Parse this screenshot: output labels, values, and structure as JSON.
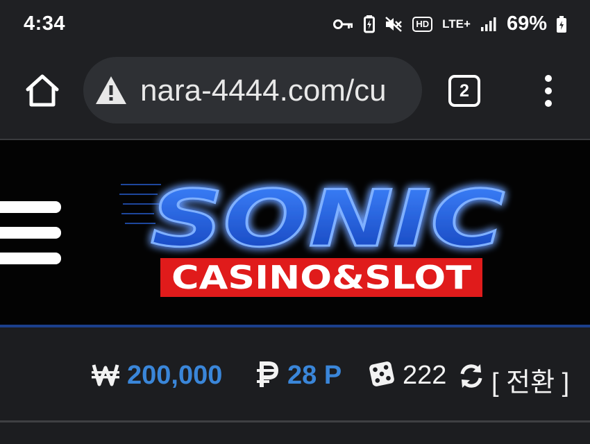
{
  "status_bar": {
    "time": "4:34",
    "battery_percent": "69%",
    "network": "LTE+",
    "hd_label": "HD"
  },
  "browser": {
    "url": "nara-4444.com/cu",
    "tab_count": "2"
  },
  "site": {
    "logo_title": "SONIC",
    "logo_subtitle": "CASINO&SLOT",
    "balance": {
      "money_value": "200,000",
      "points_value": "28 P",
      "game_count": "222",
      "switch_label": "[ 전환 ]"
    }
  },
  "colors": {
    "accent_blue": "#3a86d9",
    "logo_red": "#e01b1b",
    "logo_yellow": "#ffd200",
    "header_divider": "#1b3f8c"
  },
  "icons": {
    "key": "key-icon",
    "battery_saver": "battery-saver-icon",
    "mute": "mute-icon",
    "signal": "signal-icon",
    "battery": "battery-charging-icon",
    "home": "home-icon",
    "warning": "warning-icon",
    "tabs": "tabs-icon",
    "menu": "more-vert-icon",
    "hamburger": "hamburger-menu-icon",
    "won": "won-icon",
    "point": "point-icon",
    "dice": "dice-icon",
    "refresh": "refresh-icon"
  }
}
